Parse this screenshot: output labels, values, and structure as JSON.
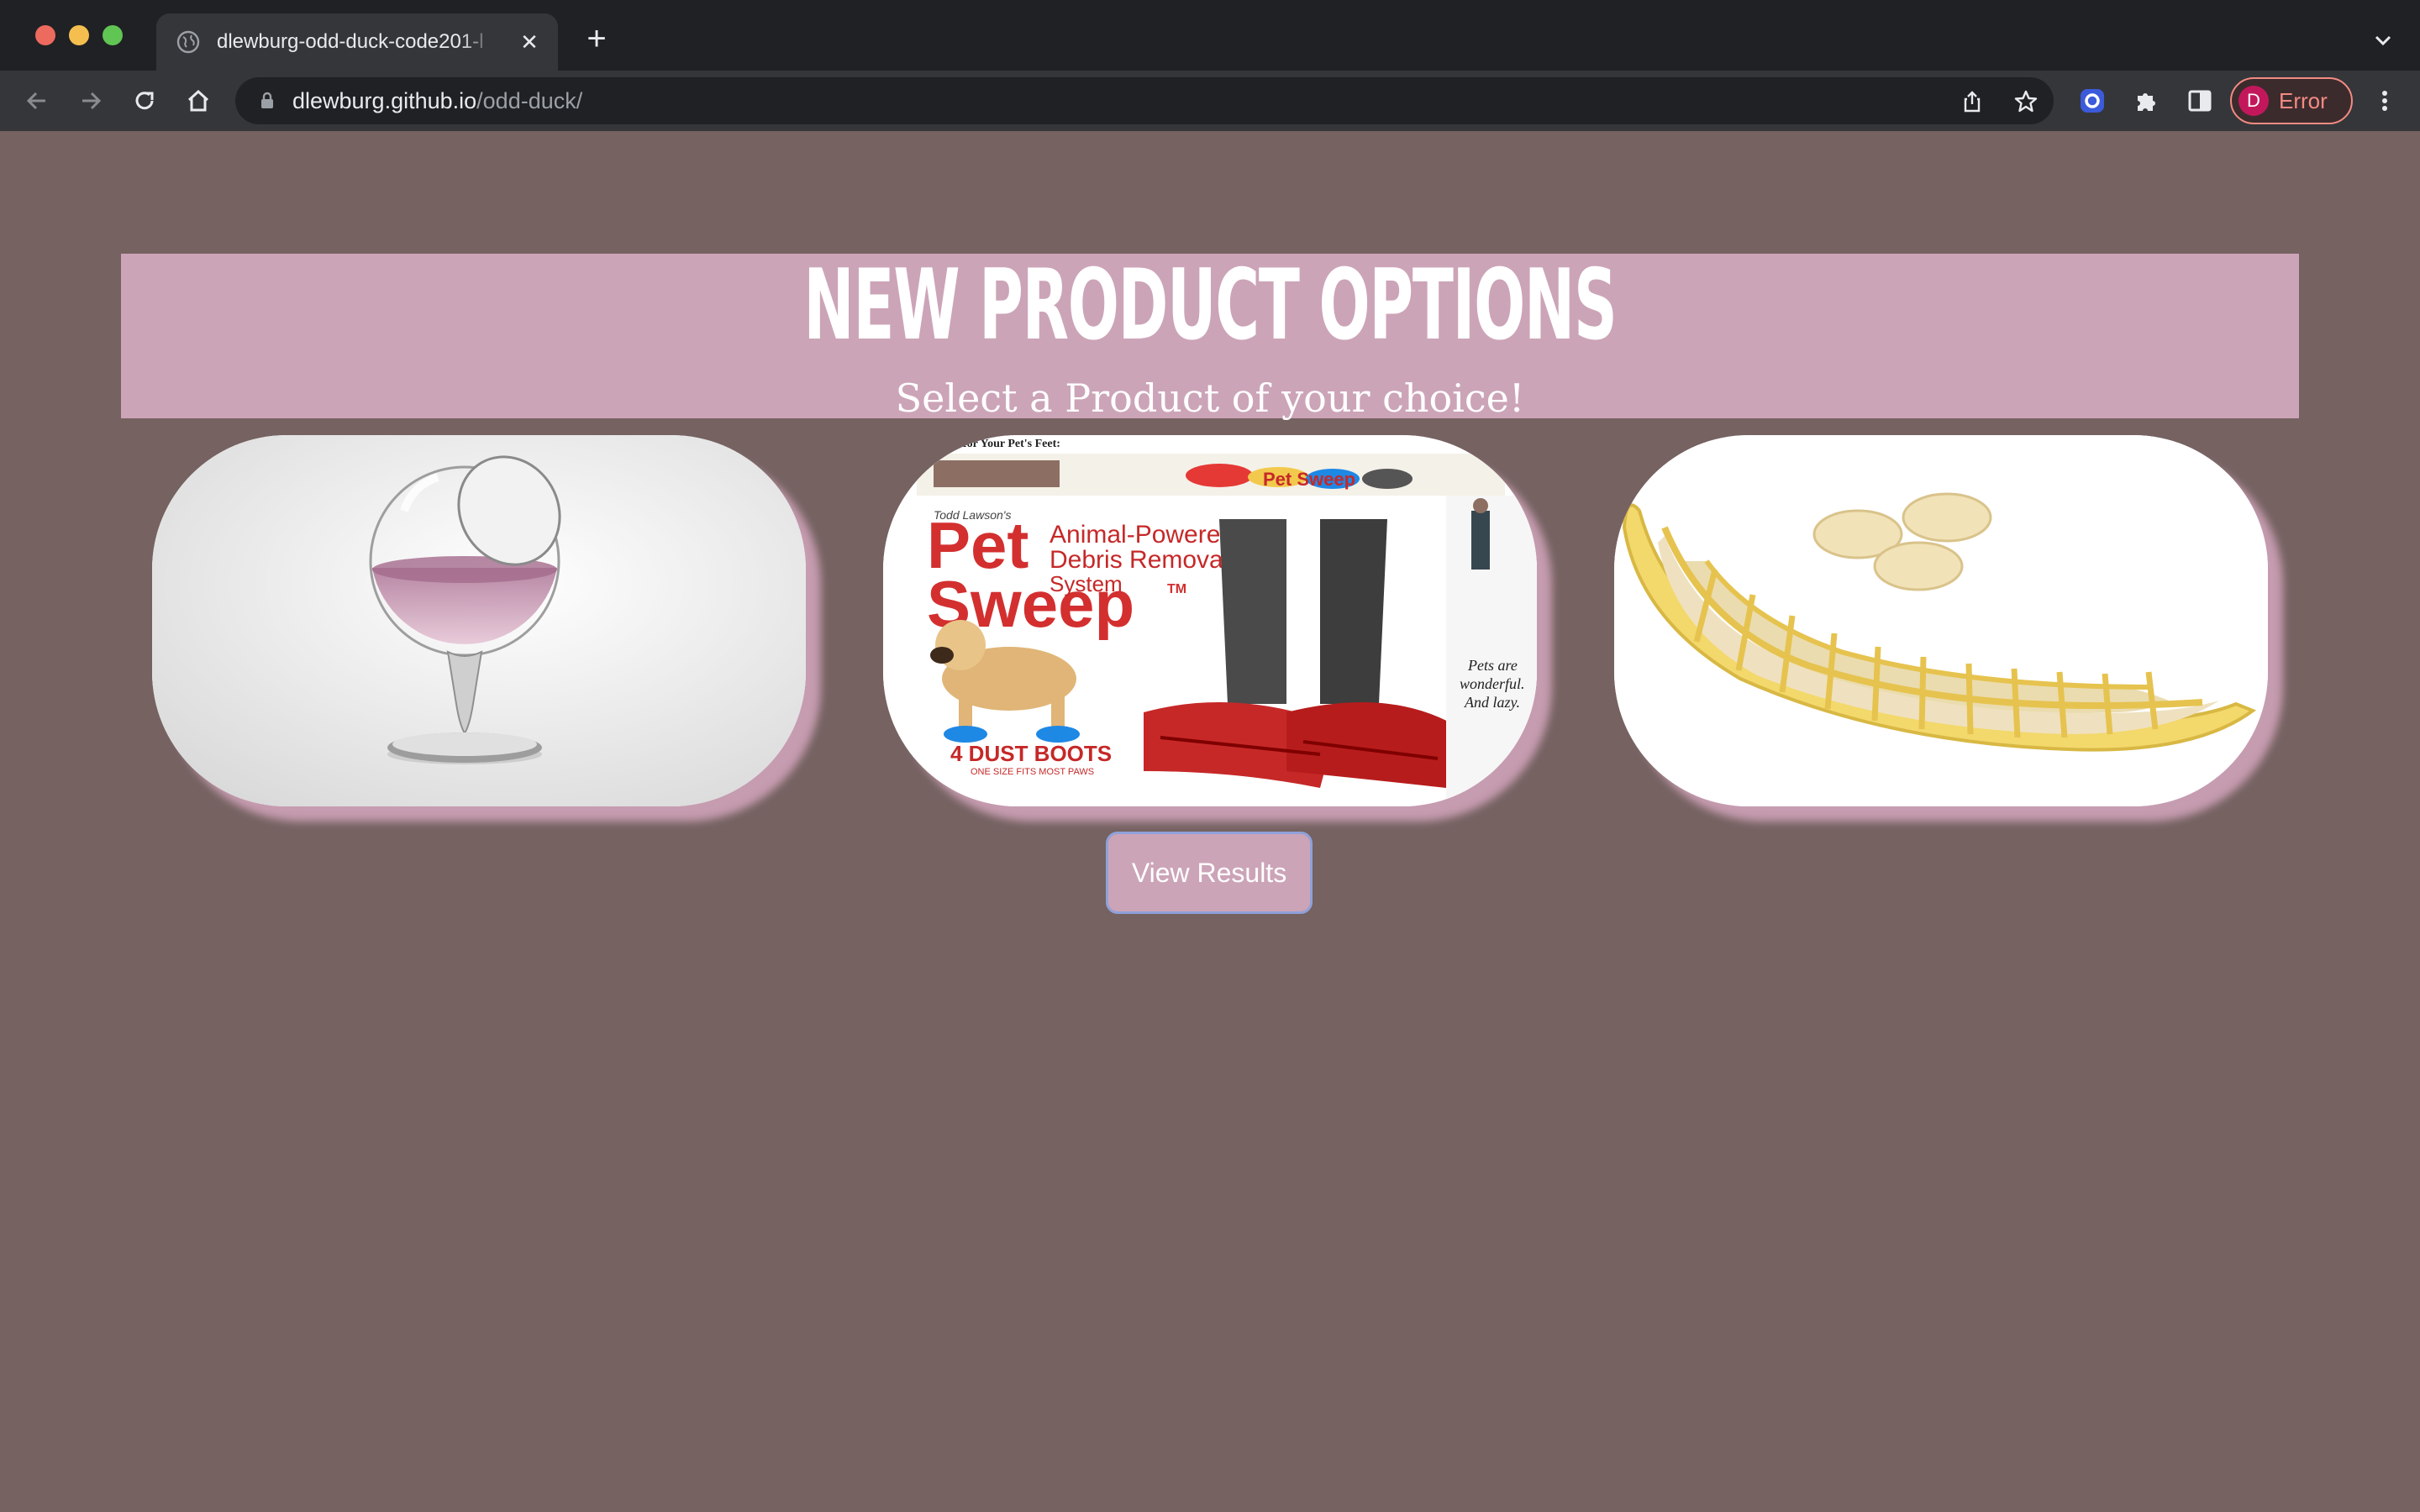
{
  "browser": {
    "tab_title": "dlewburg-odd-duck-code201-l",
    "url_host": "dlewburg.github.io",
    "url_path": "/odd-duck/",
    "profile_initial": "D",
    "profile_status": "Error",
    "icons": [
      "globe-icon",
      "close-icon",
      "plus-icon",
      "back-icon",
      "forward-icon",
      "reload-icon",
      "home-icon",
      "lock-icon",
      "share-icon",
      "star-icon",
      "extension-icon",
      "puzzle-icon",
      "sidepanel-icon",
      "menu-icon",
      "chevron-down-icon"
    ]
  },
  "page": {
    "title": "NEW PRODUCT OPTIONS",
    "subtitle": "Select a Product of your choice!",
    "button_label": "View Results",
    "products": [
      {
        "name": "wine-glass",
        "image_text": []
      },
      {
        "name": "pet-sweep",
        "image_text": {
          "top": "s for Your Pet's Feet:",
          "brand_small": "Todd Lawson's",
          "brand_line1": "Pet",
          "brand_line2": "Sweep",
          "tm": "TM",
          "tagline_1": "Animal-Powered",
          "tagline_2": "Debris Removal",
          "tagline_3": "System",
          "boots_1": "4 DUST BOOTS",
          "boots_2": "ONE SIZE FITS MOST PAWS",
          "side_1": "Pets are",
          "side_2": "wonderful.",
          "side_3": "And lazy."
        }
      },
      {
        "name": "banana-slicer",
        "image_text": []
      }
    ]
  },
  "colors": {
    "page_bg": "#756261",
    "banner_bg": "#cca4b7",
    "shadow": "#c69cb0",
    "button_border": "#8fa1d9"
  }
}
